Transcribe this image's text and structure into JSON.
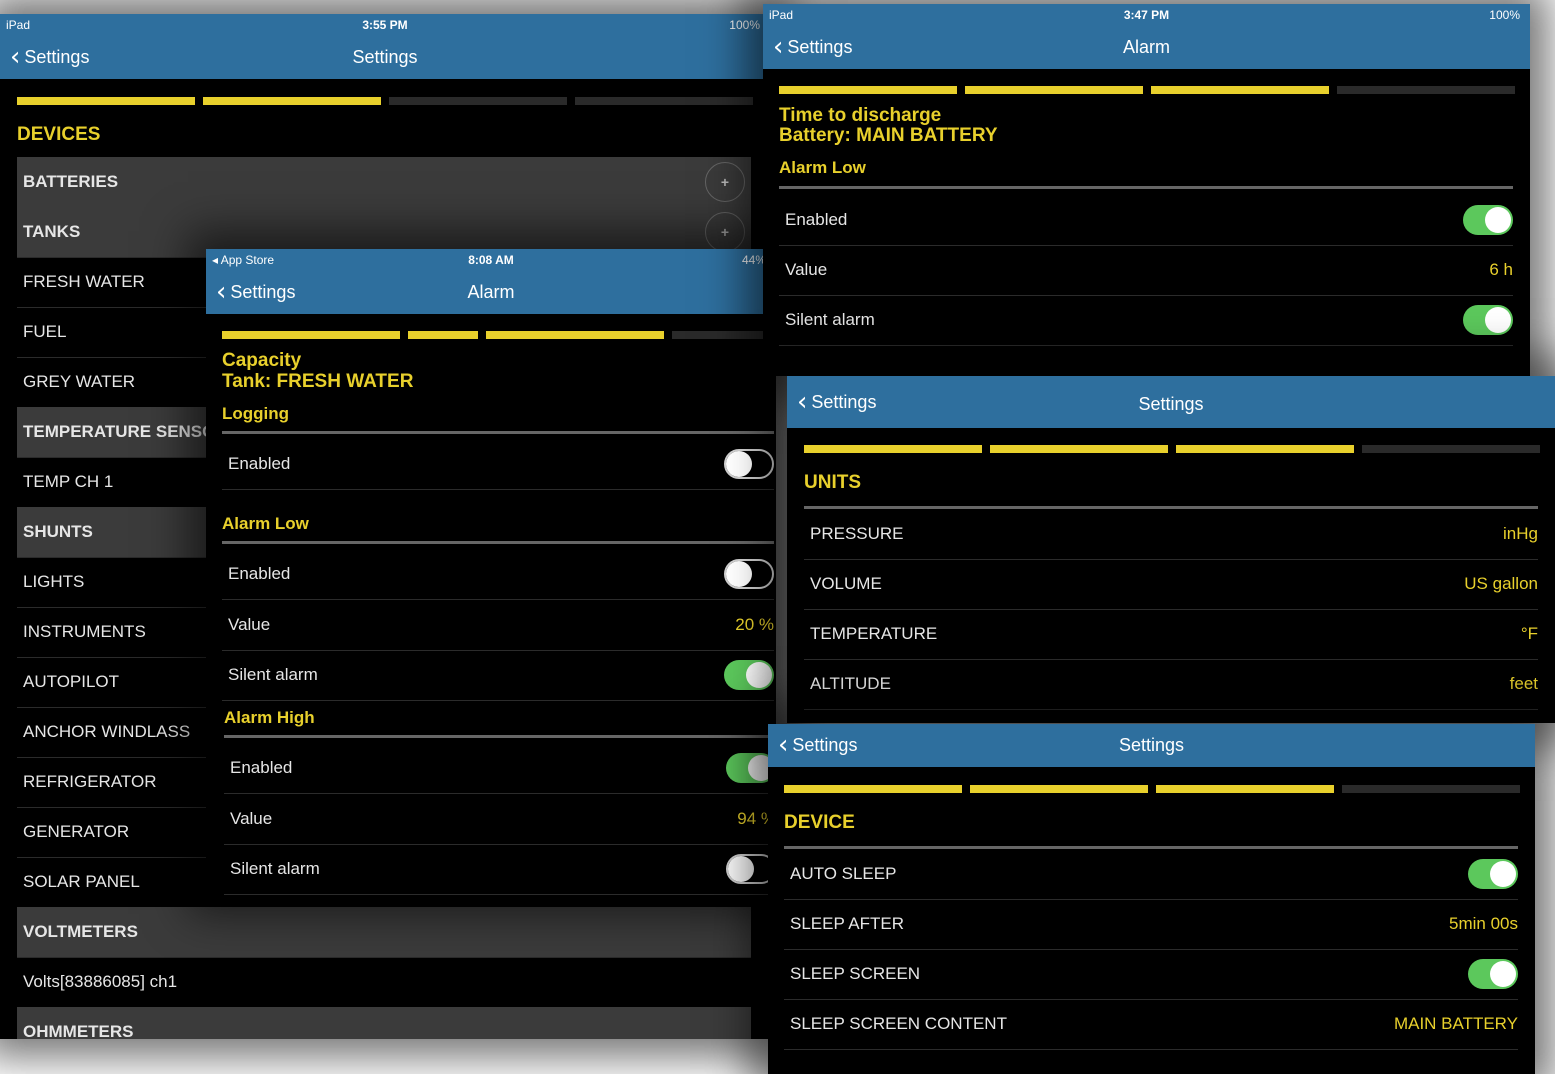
{
  "screen_a": {
    "status": {
      "left": "iPad",
      "time": "3:55 PM",
      "right": "100%"
    },
    "nav": {
      "back": "Settings",
      "title": "Settings"
    },
    "section": "DEVICES",
    "rows": [
      {
        "label": "BATTERIES",
        "group": true,
        "plus": true
      },
      {
        "label": "TANKS",
        "group": true,
        "plus": true
      },
      {
        "label": "FRESH WATER"
      },
      {
        "label": "FUEL"
      },
      {
        "label": "GREY WATER"
      },
      {
        "label": "TEMPERATURE SENSORS",
        "group": true
      },
      {
        "label": "TEMP CH 1"
      },
      {
        "label": "SHUNTS",
        "group": true
      },
      {
        "label": "LIGHTS"
      },
      {
        "label": "INSTRUMENTS"
      },
      {
        "label": "AUTOPILOT"
      },
      {
        "label": "ANCHOR WINDLASS"
      },
      {
        "label": "REFRIGERATOR"
      },
      {
        "label": "GENERATOR"
      },
      {
        "label": "SOLAR PANEL"
      },
      {
        "label": "VOLTMETERS",
        "group": true
      },
      {
        "label": "Volts[83886085] ch1"
      },
      {
        "label": "OHMMETERS",
        "group": true
      }
    ]
  },
  "screen_b": {
    "status": {
      "left": "App Store",
      "time": "8:08 AM",
      "right": "44%"
    },
    "nav": {
      "back": "Settings",
      "title": "Alarm"
    },
    "heading1": "Capacity",
    "heading2": "Tank: FRESH WATER",
    "logging": {
      "title": "Logging",
      "enabled_label": "Enabled",
      "enabled": false
    },
    "alarm_low": {
      "title": "Alarm Low",
      "enabled_label": "Enabled",
      "enabled": false,
      "value_label": "Value",
      "value": "20 %",
      "silent_label": "Silent alarm",
      "silent": true
    },
    "alarm_high": {
      "title": "Alarm High",
      "enabled_label": "Enabled",
      "enabled": true,
      "value_label": "Value",
      "value": "94 %",
      "silent_label": "Silent alarm",
      "silent": false
    }
  },
  "screen_c": {
    "status": {
      "left": "iPad",
      "time": "3:47 PM",
      "right": "100%"
    },
    "nav": {
      "back": "Settings",
      "title": "Alarm"
    },
    "heading1": "Time to discharge",
    "heading2": "Battery: MAIN BATTERY",
    "alarm_low": {
      "title": "Alarm Low",
      "enabled_label": "Enabled",
      "enabled": true,
      "value_label": "Value",
      "value": "6 h",
      "silent_label": "Silent alarm",
      "silent": true
    }
  },
  "screen_d": {
    "nav": {
      "back": "Settings",
      "title": "Settings"
    },
    "section": "UNITS",
    "rows": [
      {
        "label": "PRESSURE",
        "value": "inHg"
      },
      {
        "label": "VOLUME",
        "value": "US gallon"
      },
      {
        "label": "TEMPERATURE",
        "value": "°F"
      },
      {
        "label": "ALTITUDE",
        "value": "feet"
      }
    ]
  },
  "screen_e": {
    "nav": {
      "back": "Settings",
      "title": "Settings"
    },
    "section": "DEVICE",
    "auto_sleep": {
      "label": "AUTO SLEEP",
      "on": true
    },
    "sleep_after": {
      "label": "SLEEP AFTER",
      "value": "5min 00s"
    },
    "sleep_screen": {
      "label": "SLEEP SCREEN",
      "on": true
    },
    "sleep_screen_content": {
      "label": "SLEEP SCREEN CONTENT",
      "value": "MAIN BATTERY"
    }
  },
  "colors": {
    "accent": "#e8d02c",
    "navbar": "#2e6f9e",
    "toggle_on": "#5cc85c"
  }
}
